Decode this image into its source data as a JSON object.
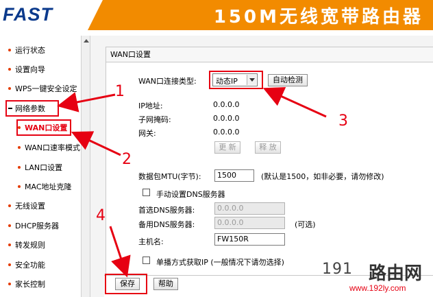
{
  "header": {
    "logo": "FAST",
    "title": "150M无线宽带路由器"
  },
  "sidebar": {
    "items": [
      {
        "label": "运行状态"
      },
      {
        "label": "设置向导"
      },
      {
        "label": "WPS一键安全设定"
      },
      {
        "label": "网络参数"
      },
      {
        "label": "WAN口设置"
      },
      {
        "label": "WAN口速率模式"
      },
      {
        "label": "LAN口设置"
      },
      {
        "label": "MAC地址克隆"
      },
      {
        "label": "无线设置"
      },
      {
        "label": "DHCP服务器"
      },
      {
        "label": "转发规则"
      },
      {
        "label": "安全功能"
      },
      {
        "label": "家长控制"
      }
    ]
  },
  "panel": {
    "title": "WAN口设置",
    "conn_type_label": "WAN口连接类型:",
    "conn_type_value": "动态IP",
    "auto_detect": "自动检测",
    "ip_label": "IP地址:",
    "ip_value": "0.0.0.0",
    "mask_label": "子网掩码:",
    "mask_value": "0.0.0.0",
    "gateway_label": "网关:",
    "gateway_value": "0.0.0.0",
    "renew": "更 新",
    "release": "释 放",
    "mtu_label": "数据包MTU(字节):",
    "mtu_value": "1500",
    "mtu_hint": "(默认是1500，如非必要，请勿修改)",
    "manual_dns_label": "手动设置DNS服务器",
    "dns1_label": "首选DNS服务器:",
    "dns1_value": "0.0.0.0",
    "dns2_label": "备用DNS服务器:",
    "dns2_value": "0.0.0.0",
    "dns2_hint": "(可选)",
    "hostname_label": "主机名:",
    "hostname_value": "FW150R",
    "unicast_label": "单播方式获取IP  (一般情况下请勿选择)"
  },
  "footer": {
    "save": "保存",
    "help": "帮助"
  },
  "annotations": {
    "n1": "1",
    "n2": "2",
    "n3": "3",
    "n4": "4",
    "color": "#e60012"
  },
  "watermark": {
    "number": "191",
    "text": "路由网",
    "url": "www.192ly.com"
  }
}
